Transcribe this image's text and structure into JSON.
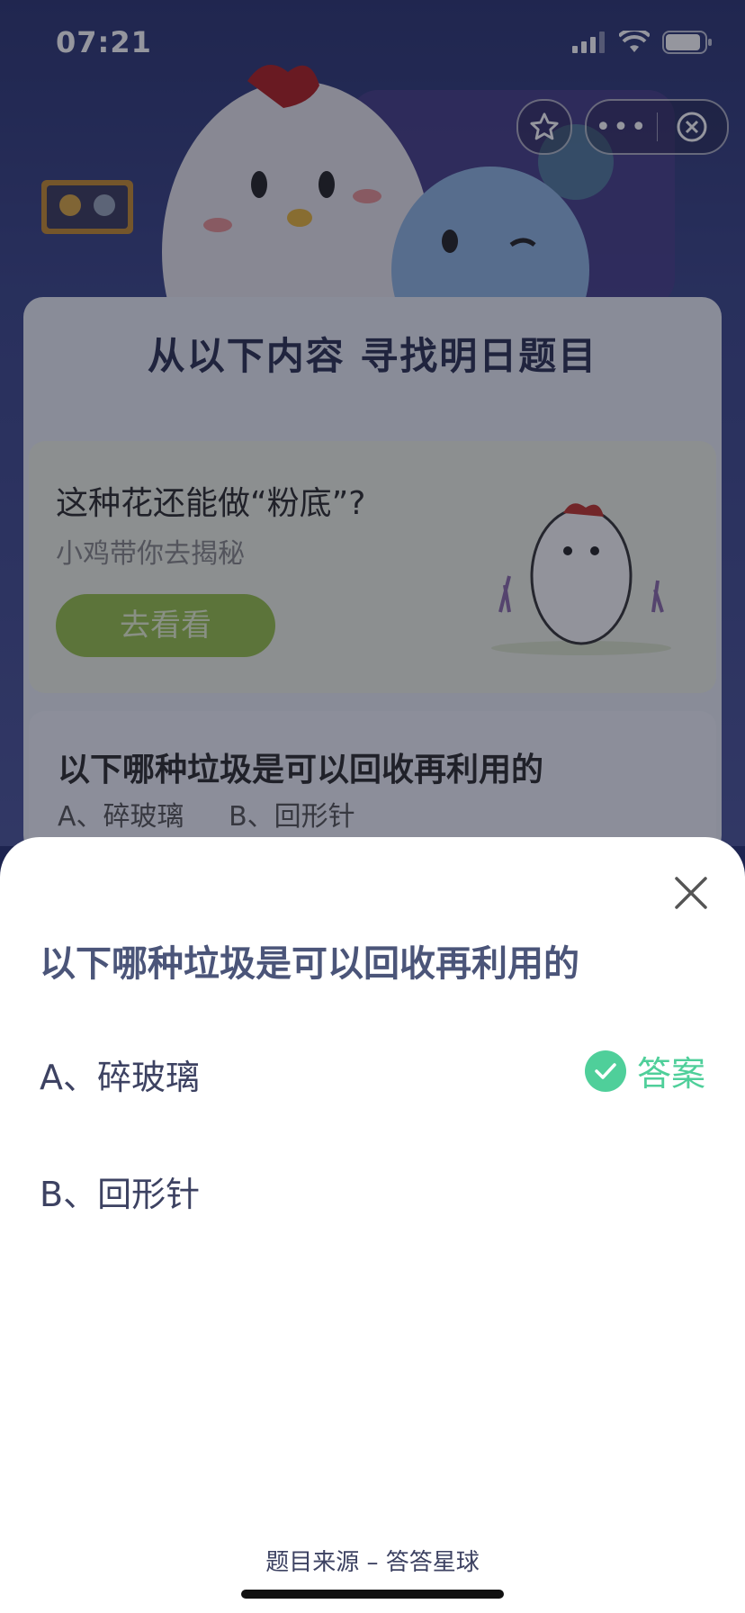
{
  "status_bar": {
    "time": "07:21"
  },
  "capsule": {
    "more_label": "•••"
  },
  "panel": {
    "title": "从以下内容 寻找明日题目",
    "card1": {
      "question": "这种花还能做“粉底”?",
      "subtitle": "小鸡带你去揭秘",
      "button": "去看看"
    },
    "card2": {
      "question": "以下哪种垃圾是可以回收再利用的",
      "options": [
        "A、碎玻璃",
        "B、回形针"
      ]
    }
  },
  "sheet": {
    "title": "以下哪种垃圾是可以回收再利用的",
    "options": [
      {
        "label": "A、碎玻璃",
        "is_answer": true
      },
      {
        "label": "B、回形针",
        "is_answer": false
      }
    ],
    "answer_label": "答案",
    "source": "题目来源 – 答答星球",
    "answer_color": "#4fcf9a"
  }
}
